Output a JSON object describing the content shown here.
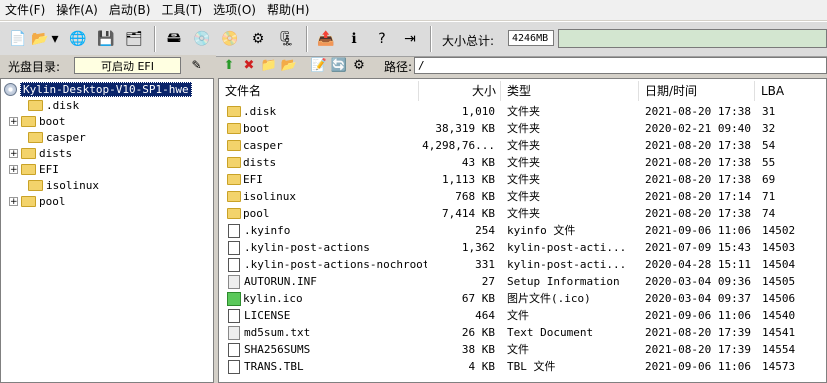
{
  "menu": [
    "文件(F)",
    "操作(A)",
    "启动(B)",
    "工具(T)",
    "选项(O)",
    "帮助(H)"
  ],
  "toolbar": {
    "buttons": [
      {
        "name": "new-icon",
        "glyph": "📄"
      },
      {
        "name": "open-icon",
        "glyph": "📂"
      },
      {
        "name": "dropdown-icon",
        "glyph": "▾"
      },
      {
        "name": "globe-icon",
        "glyph": "🌐"
      },
      {
        "name": "save-icon",
        "glyph": "💾"
      },
      {
        "name": "save-as-icon",
        "glyph": "🗂"
      },
      {
        "name": "drive-icon",
        "glyph": "🖴"
      },
      {
        "name": "burn-icon",
        "glyph": "💿"
      },
      {
        "name": "mount-icon",
        "glyph": "📀"
      },
      {
        "name": "properties-icon",
        "glyph": "⚙"
      },
      {
        "name": "compress-icon",
        "glyph": "🗜"
      },
      {
        "name": "export-icon",
        "glyph": "📤"
      },
      {
        "name": "info-icon",
        "glyph": "ℹ"
      },
      {
        "name": "help-icon",
        "glyph": "?"
      },
      {
        "name": "exit-icon",
        "glyph": "⇥"
      }
    ],
    "size_label": "大小总计:",
    "size_value": "4246MB",
    "size_fill": 1.0
  },
  "disc": {
    "label": "光盘目录:",
    "bootable": "可启动 EFI"
  },
  "file_tools": {
    "buttons": [
      {
        "name": "up-icon",
        "glyph": "⬆"
      },
      {
        "name": "delete-icon",
        "glyph": "✖"
      },
      {
        "name": "add-folder-icon",
        "glyph": "📁"
      },
      {
        "name": "add-file-icon",
        "glyph": "📂"
      },
      {
        "name": "rename-icon",
        "glyph": "📝"
      },
      {
        "name": "refresh-icon",
        "glyph": "🔄"
      },
      {
        "name": "settings-icon",
        "glyph": "⚙"
      },
      {
        "name": "view-icon",
        "glyph": "🔁"
      }
    ],
    "path_label": "路径:",
    "path": "/"
  },
  "tree": {
    "root": "Kylin-Desktop-V10-SP1-hwe",
    "children": [
      {
        "label": ".disk",
        "expandable": false
      },
      {
        "label": "boot",
        "expandable": true
      },
      {
        "label": "casper",
        "expandable": false
      },
      {
        "label": "dists",
        "expandable": true
      },
      {
        "label": "EFI",
        "expandable": true
      },
      {
        "label": "isolinux",
        "expandable": false
      },
      {
        "label": "pool",
        "expandable": true
      }
    ]
  },
  "list": {
    "columns": [
      "文件名",
      "大小",
      "类型",
      "日期/时间",
      "LBA"
    ],
    "rows": [
      {
        "name": ".disk",
        "icon": "folder",
        "size": "1,010",
        "type": "文件夹",
        "date": "2021-08-20 17:38",
        "lba": "31"
      },
      {
        "name": "boot",
        "icon": "folder",
        "size": "38,319 KB",
        "type": "文件夹",
        "date": "2020-02-21 09:40",
        "lba": "32"
      },
      {
        "name": "casper",
        "icon": "folder",
        "size": "4,298,76...",
        "type": "文件夹",
        "date": "2021-08-20 17:38",
        "lba": "54"
      },
      {
        "name": "dists",
        "icon": "folder",
        "size": "43 KB",
        "type": "文件夹",
        "date": "2021-08-20 17:38",
        "lba": "55"
      },
      {
        "name": "EFI",
        "icon": "folder",
        "size": "1,113 KB",
        "type": "文件夹",
        "date": "2021-08-20 17:38",
        "lba": "69"
      },
      {
        "name": "isolinux",
        "icon": "folder",
        "size": "768 KB",
        "type": "文件夹",
        "date": "2021-08-20 17:14",
        "lba": "71"
      },
      {
        "name": "pool",
        "icon": "folder",
        "size": "7,414 KB",
        "type": "文件夹",
        "date": "2021-08-20 17:38",
        "lba": "74"
      },
      {
        "name": ".kyinfo",
        "icon": "file",
        "size": "254",
        "type": "kyinfo 文件",
        "date": "2021-09-06 11:06",
        "lba": "14502"
      },
      {
        "name": ".kylin-post-actions",
        "icon": "file",
        "size": "1,362",
        "type": "kylin-post-acti...",
        "date": "2021-07-09 15:43",
        "lba": "14503"
      },
      {
        "name": ".kylin-post-actions-nochroot",
        "icon": "file",
        "size": "331",
        "type": "kylin-post-acti...",
        "date": "2020-04-28 15:11",
        "lba": "14504"
      },
      {
        "name": "AUTORUN.INF",
        "icon": "inf",
        "size": "27",
        "type": "Setup Information",
        "date": "2020-03-04 09:36",
        "lba": "14505"
      },
      {
        "name": "kylin.ico",
        "icon": "ico",
        "size": "67 KB",
        "type": "图片文件(.ico)",
        "date": "2020-03-04 09:37",
        "lba": "14506"
      },
      {
        "name": "LICENSE",
        "icon": "file",
        "size": "464",
        "type": "文件",
        "date": "2021-09-06 11:06",
        "lba": "14540"
      },
      {
        "name": "md5sum.txt",
        "icon": "inf",
        "size": "26 KB",
        "type": "Text Document",
        "date": "2021-08-20 17:39",
        "lba": "14541"
      },
      {
        "name": "SHA256SUMS",
        "icon": "file",
        "size": "38 KB",
        "type": "文件",
        "date": "2021-08-20 17:39",
        "lba": "14554"
      },
      {
        "name": "TRANS.TBL",
        "icon": "file",
        "size": "4 KB",
        "type": "TBL 文件",
        "date": "2021-09-06 11:06",
        "lba": "14573"
      }
    ]
  }
}
